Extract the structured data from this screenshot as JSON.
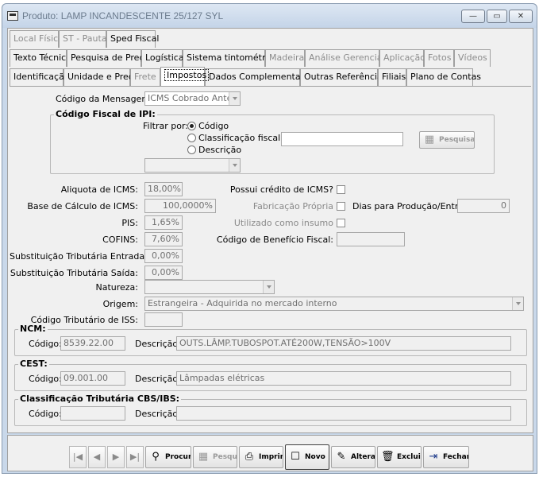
{
  "window": {
    "title": "Produto: LAMP INCANDESCENTE  25/127 SYL",
    "controls": {
      "minimize": "—",
      "maximize": "▭",
      "close": "✕"
    }
  },
  "tabs": {
    "row1": [
      "Local Físico",
      "ST - Pauta",
      "Sped Fiscal"
    ],
    "row2": [
      "Texto Técnico",
      "Pesquisa de Preço",
      "Logística",
      "Sistema tintométrico",
      "Madeira",
      "Análise Gerencial",
      "Aplicação",
      "Fotos",
      "Vídeos"
    ],
    "row3": [
      "Identificação",
      "Unidade e Preço",
      "Frete",
      "Impostos",
      "Dados Complementares",
      "Outras Referências",
      "Filiais",
      "Plano de Contas"
    ]
  },
  "form": {
    "codigo_mensagem_label": "Código da Mensagem:",
    "codigo_mensagem_value": "ICMS Cobrado Anterior",
    "ipi_group_title": "Código Fiscal de IPI:",
    "filtrar_label": "Filtrar por:",
    "filtro_opcoes": [
      "Código",
      "Classificação fiscal",
      "Descrição"
    ],
    "pesquisa_label": "Pesquisa",
    "aliquota_icms_label": "Aliquota de ICMS:",
    "aliquota_icms_value": "18,00%",
    "base_calculo_label": "Base de Cálculo de ICMS:",
    "base_calculo_value": "100,0000%",
    "pis_label": "PIS:",
    "pis_value": "1,65%",
    "cofins_label": "COFINS:",
    "cofins_value": "7,60%",
    "st_entrada_label": "Substituição Tributária Entrada:",
    "st_entrada_value": "0,00%",
    "st_saida_label": "Substituição Tributária Saída:",
    "st_saida_value": "0,00%",
    "natureza_label": "Natureza:",
    "natureza_value": "",
    "origem_label": "Origem:",
    "origem_value": "Estrangeira - Adquirida no mercado interno",
    "iss_label": "Código Tributário de ISS:",
    "iss_value": "",
    "credito_icms_label": "Possui crédito de ICMS?",
    "fabricacao_label": "Fabricação Própria",
    "dias_producao_label": "Dias para Produção/Entrega:",
    "dias_producao_value": "0",
    "insumo_label": "Utilizado como insumo",
    "beneficio_label": "Código de Benefício Fiscal:",
    "beneficio_value": ""
  },
  "ncm": {
    "title": "NCM:",
    "codigo_label": "Código:",
    "codigo_value": "8539.22.00",
    "descricao_label": "Descrição:",
    "descricao_value": "OUTS.LÂMP.TUBOSPOT.ATÉ200W,TENSÃO>100V"
  },
  "cest": {
    "title": "CEST:",
    "codigo_label": "Código:",
    "codigo_value": "09.001.00",
    "descricao_label": "Descrição:",
    "descricao_value": "Lâmpadas elétricas"
  },
  "cbs": {
    "title": "Classificação Tributária CBS/IBS:",
    "codigo_label": "Código:",
    "codigo_value": "",
    "descricao_label": "Descrição:",
    "descricao_value": ""
  },
  "toolbar": {
    "nav": [
      "|◀",
      "◀",
      "▶",
      "▶|"
    ],
    "procurar": "Procurar",
    "pesquisa": "Pesquisa",
    "imprimir": "Imprimir",
    "novo": "Novo",
    "alterar": "Alterar",
    "excluir": "Excluir",
    "fechar": "Fechar"
  },
  "icons": {
    "app": "app-icon",
    "binoculars": "binoculars-icon",
    "grid": "grid-icon",
    "printer": "printer-icon",
    "new": "new-icon",
    "edit": "edit-icon",
    "delete": "trash-icon",
    "close": "exit-door-icon"
  }
}
